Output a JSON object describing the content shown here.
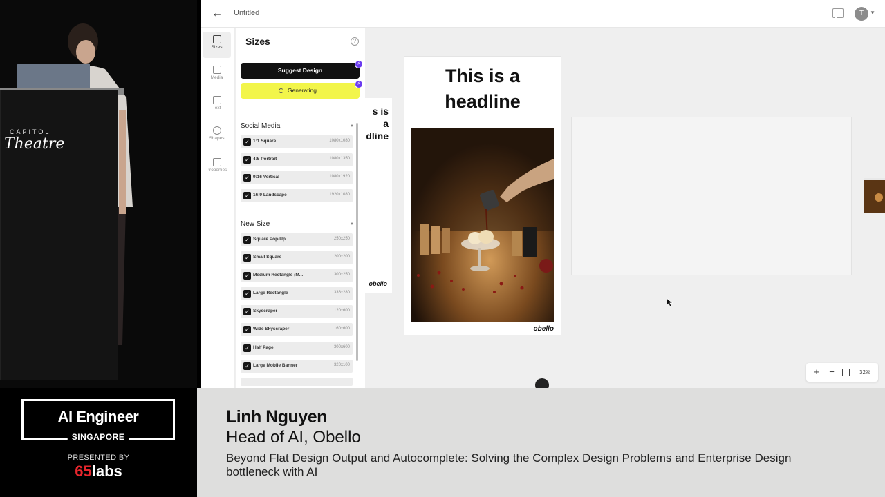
{
  "app": {
    "doc_title": "Untitled",
    "avatar_initial": "T"
  },
  "rail": [
    {
      "label": "Sizes",
      "icon": "sizes-icon",
      "active": true
    },
    {
      "label": "Media",
      "icon": "media-icon",
      "active": false
    },
    {
      "label": "Text",
      "icon": "text-icon",
      "active": false
    },
    {
      "label": "Shapes",
      "icon": "shapes-icon",
      "active": false
    },
    {
      "label": "Properties",
      "icon": "properties-icon",
      "active": false
    }
  ],
  "panel": {
    "title": "Sizes",
    "suggest_label": "Suggest Design",
    "generating_label": "Generating...",
    "sections": [
      {
        "title": "Social Media",
        "items": [
          {
            "name": "1:1 Square",
            "dims": "1080x1080"
          },
          {
            "name": "4:5 Portrait",
            "dims": "1080x1350"
          },
          {
            "name": "9:16 Vertical",
            "dims": "1080x1920"
          },
          {
            "name": "16:9 Landscape",
            "dims": "1920x1080"
          }
        ]
      },
      {
        "title": "New Size",
        "items": [
          {
            "name": "Square Pop-Up",
            "dims": "250x250"
          },
          {
            "name": "Small Square",
            "dims": "200x200"
          },
          {
            "name": "Medium Rectangle (M...",
            "dims": "300x250"
          },
          {
            "name": "Large Rectangle",
            "dims": "336x280"
          },
          {
            "name": "Skyscraper",
            "dims": "120x600"
          },
          {
            "name": "Wide Skyscraper",
            "dims": "160x600"
          },
          {
            "name": "Half Page",
            "dims": "300x600"
          },
          {
            "name": "Large Mobile Banner",
            "dims": "320x100"
          }
        ]
      }
    ]
  },
  "canvas": {
    "headline_line1": "This is a",
    "headline_line2": "headline",
    "small_frame_line1": "s is a",
    "small_frame_line2": "dline",
    "brand_logo": "obello",
    "zoom_level": "32%"
  },
  "lower_third": {
    "event_title": "AI Engineer",
    "event_location": "SINGAPORE",
    "presented_by": "PRESENTED BY",
    "sponsor_number": "65",
    "sponsor_word": "labs",
    "speaker_name": "Linh Nguyen",
    "speaker_role": "Head of AI, Obello",
    "talk_title": "Beyond Flat Design Output and Autocomplete: Solving the Complex Design Problems and Enterprise Design bottleneck with AI"
  },
  "stage": {
    "podium_line1": "CAPITOL",
    "podium_line2": "Theatre"
  }
}
